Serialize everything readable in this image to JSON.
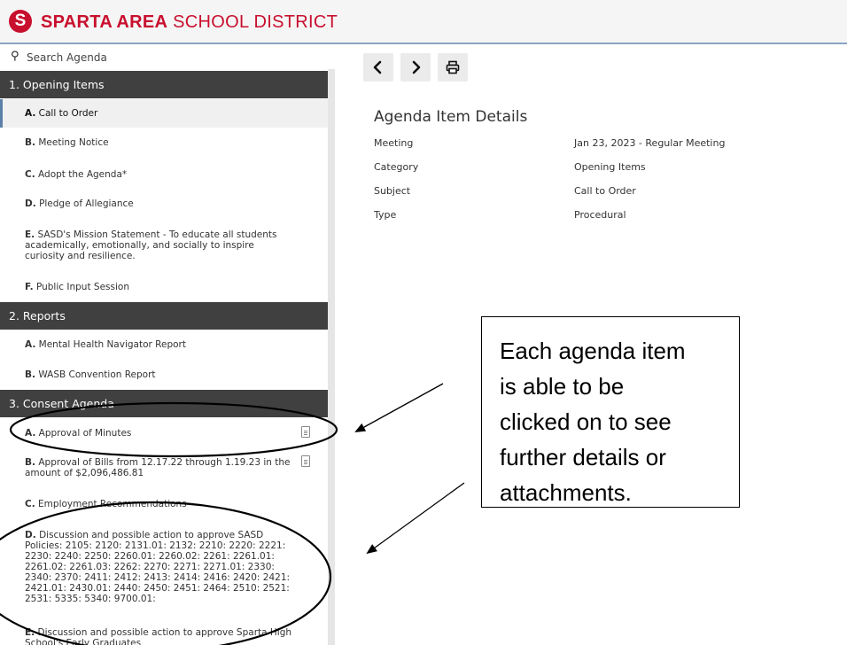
{
  "header": {
    "logo_letter": "S",
    "brand_bold": "SPARTA AREA",
    "brand_rest": "SCHOOL DISTRICT"
  },
  "sidebar": {
    "search": {
      "icon": "search-icon",
      "placeholder": "Search Agenda"
    },
    "sections": [
      {
        "title": "1. Opening Items",
        "items": [
          {
            "key": "A.",
            "label": "Call to Order"
          },
          {
            "key": "B.",
            "label": "Meeting Notice"
          },
          {
            "key": "C.",
            "label": "Adopt the Agenda*"
          },
          {
            "key": "D.",
            "label": "Pledge of Allegiance"
          },
          {
            "key": "E.",
            "label": "SASD's Mission Statement - To educate all students academically, emotionally, and socially to inspire curiosity and resilience."
          },
          {
            "key": "F.",
            "label": "Public Input Session"
          }
        ]
      },
      {
        "title": "2. Reports",
        "items": [
          {
            "key": "A.",
            "label": "Mental Health Navigator Report"
          },
          {
            "key": "B.",
            "label": "WASB Convention Report"
          }
        ]
      },
      {
        "title": "3. Consent Agenda",
        "items": [
          {
            "key": "A.",
            "label": "Approval of Minutes",
            "icon": "document-icon"
          },
          {
            "key": "B.",
            "label": "Approval of Bills from 12.17.22 through 1.19.23 in the amount of $2,096,486.81",
            "icon": "document-icon"
          },
          {
            "key": "C.",
            "label": "Employment Recommendations"
          },
          {
            "key": "D.",
            "label": "Discussion and possible action to approve SASD Policies: 2105: 2120: 2131.01: 2132: 2210: 2220: 2221: 2230: 2240: 2250: 2260.01: 2260.02: 2261: 2261.01: 2261.02: 2261.03: 2262: 2270: 2271: 2271.01: 2330: 2340: 2370: 2411: 2412: 2413: 2414: 2416: 2420: 2421: 2421.01: 2430.01: 2440: 2450: 2451: 2464: 2510: 2521: 2531: 5335: 5340: 9700.01:"
          },
          {
            "key": "E.",
            "label": "Discussion and possible action to approve Sparta High School's Early Graduates"
          }
        ]
      }
    ]
  },
  "toolbar": {
    "prev_icon": "chevron-left-icon",
    "next_icon": "chevron-right-icon",
    "print_icon": "print-icon"
  },
  "details": {
    "title": "Agenda Item Details",
    "rows": [
      {
        "label": "Meeting",
        "value": "Jan 23, 2023 - Regular Meeting"
      },
      {
        "label": "Category",
        "value": "Opening Items"
      },
      {
        "label": "Subject",
        "value": "Call to Order"
      },
      {
        "label": "Type",
        "value": "Procedural"
      }
    ]
  },
  "annotation": {
    "lines": [
      "Each agenda item",
      "is able to be",
      "clicked on to see",
      "further details or",
      "attachments."
    ]
  },
  "colors": {
    "brand": "#c8102e",
    "section_bar": "#404040",
    "active_marker": "#5a7fa8"
  }
}
